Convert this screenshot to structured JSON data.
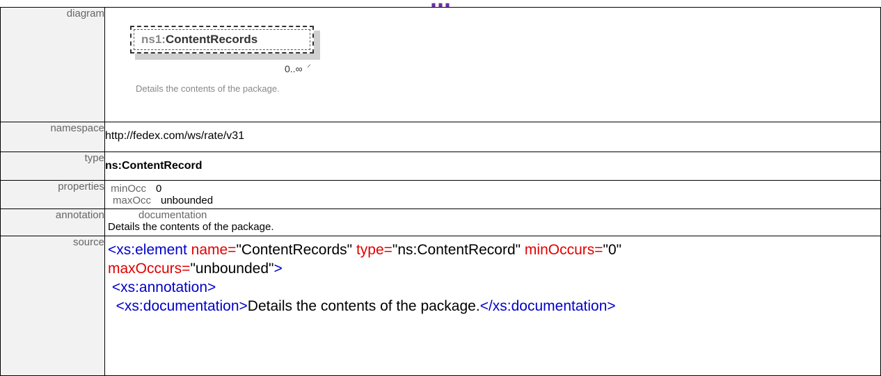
{
  "title": "...",
  "rows": {
    "diagram": {
      "label": "diagram",
      "element_prefix": "ns1:",
      "element_name": "ContentRecords",
      "multiplicity": "0..∞",
      "description": "Details the contents of the package."
    },
    "namespace": {
      "label": "namespace",
      "value": "http://fedex.com/ws/rate/v31"
    },
    "type": {
      "label": "type",
      "value": "ns:ContentRecord"
    },
    "properties": {
      "label": "properties",
      "items": [
        {
          "key": "minOcc",
          "value": "0"
        },
        {
          "key": "maxOcc",
          "value": "unbounded"
        }
      ]
    },
    "annotation": {
      "label": "annotation",
      "key": "documentation",
      "value": "Details the contents of the package."
    },
    "source": {
      "label": "source",
      "line1": {
        "tag_open": "<xs:element",
        "attr1": " name=",
        "val1": "\"ContentRecords\"",
        "attr2": " type=",
        "val2": "\"ns:ContentRecord\"",
        "attr3": " minOccurs=",
        "val3": "\"0\""
      },
      "line2": {
        "attr": "maxOccurs=",
        "val": "\"unbounded\"",
        "close": ">"
      },
      "line3": " <xs:annotation>",
      "line4": {
        "open": "  <xs:documentation>",
        "content": "Details the contents of the package.",
        "close": "</xs:documentation>"
      }
    }
  }
}
